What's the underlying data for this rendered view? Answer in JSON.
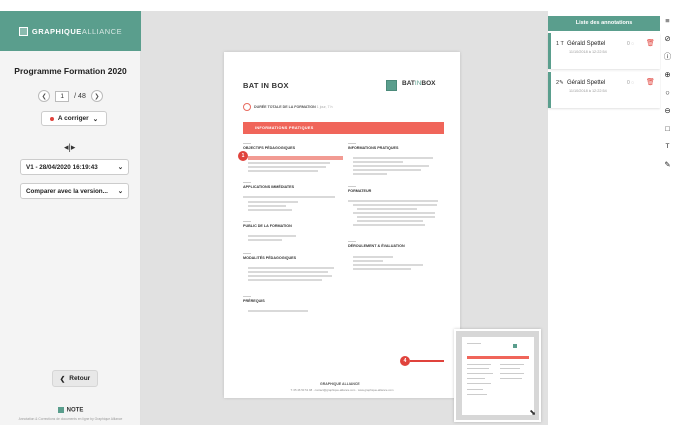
{
  "sidebar": {
    "logo_bold": "GRAPHIQUE",
    "logo_thin": "ALLIANCE",
    "title": "Programme Formation 2020",
    "page_current": "1",
    "page_total": "/ 48",
    "status_label": "A corriger",
    "version_select": "V1 - 28/04/2020 16:19:43",
    "compare_select": "Comparer avec la version...",
    "back_label": "Retour",
    "footer_brand": "NOTE",
    "footer_sub": "Annotation & Corrections de documents en ligne by Graphique Alliance"
  },
  "document": {
    "title": "BAT IN BOX",
    "brand_bold": "BAT",
    "brand_accent": "IN",
    "brand_end": "BOX",
    "duration_label": "DURÉE TOTALE DE LA FORMATION",
    "duration_value": "1 jour, 7 h",
    "banner": "INFORMATIONS PRATIQUES",
    "sections_left": [
      "OBJECTIFS PÉDAGOGIQUES",
      "APPLICATIONS IMMÉDIATES",
      "PUBLIC DE LA FORMATION",
      "MODALITÉS PÉDAGOGIQUES",
      "PRÉREQUIS"
    ],
    "sections_right": [
      "INFORMATIONS PRATIQUES",
      "FORMATEUR",
      "DÉROULEMENT & ÉVALUATION"
    ],
    "footer_logo": "GRAPHIQUE ALLIANCE",
    "footer_text": "T. 05 46 50 51 98  ·  contact@graphique-alliance.com  ·  www.graphique-alliance.com"
  },
  "annotations": {
    "header": "Liste des annotations",
    "items": [
      {
        "num": "1",
        "tool": "T",
        "author": "Gérald Spettel",
        "date": "11/10/2018 à 12:22:54",
        "count": "0"
      },
      {
        "num": "2",
        "tool": "✎",
        "author": "Gérald Spettel",
        "date": "11/10/2018 à 12:22:54",
        "count": "0"
      }
    ]
  },
  "markers": [
    "1",
    "4"
  ],
  "toolbar_icons": [
    "menu-icon",
    "hide-icon",
    "info-icon",
    "zoom-in-icon",
    "search-icon",
    "zoom-out-icon",
    "rectangle-icon",
    "text-icon",
    "pencil-icon"
  ],
  "colors": {
    "accent": "#5a9e8d",
    "marker": "#e0433c",
    "banner": "#f0655a"
  }
}
